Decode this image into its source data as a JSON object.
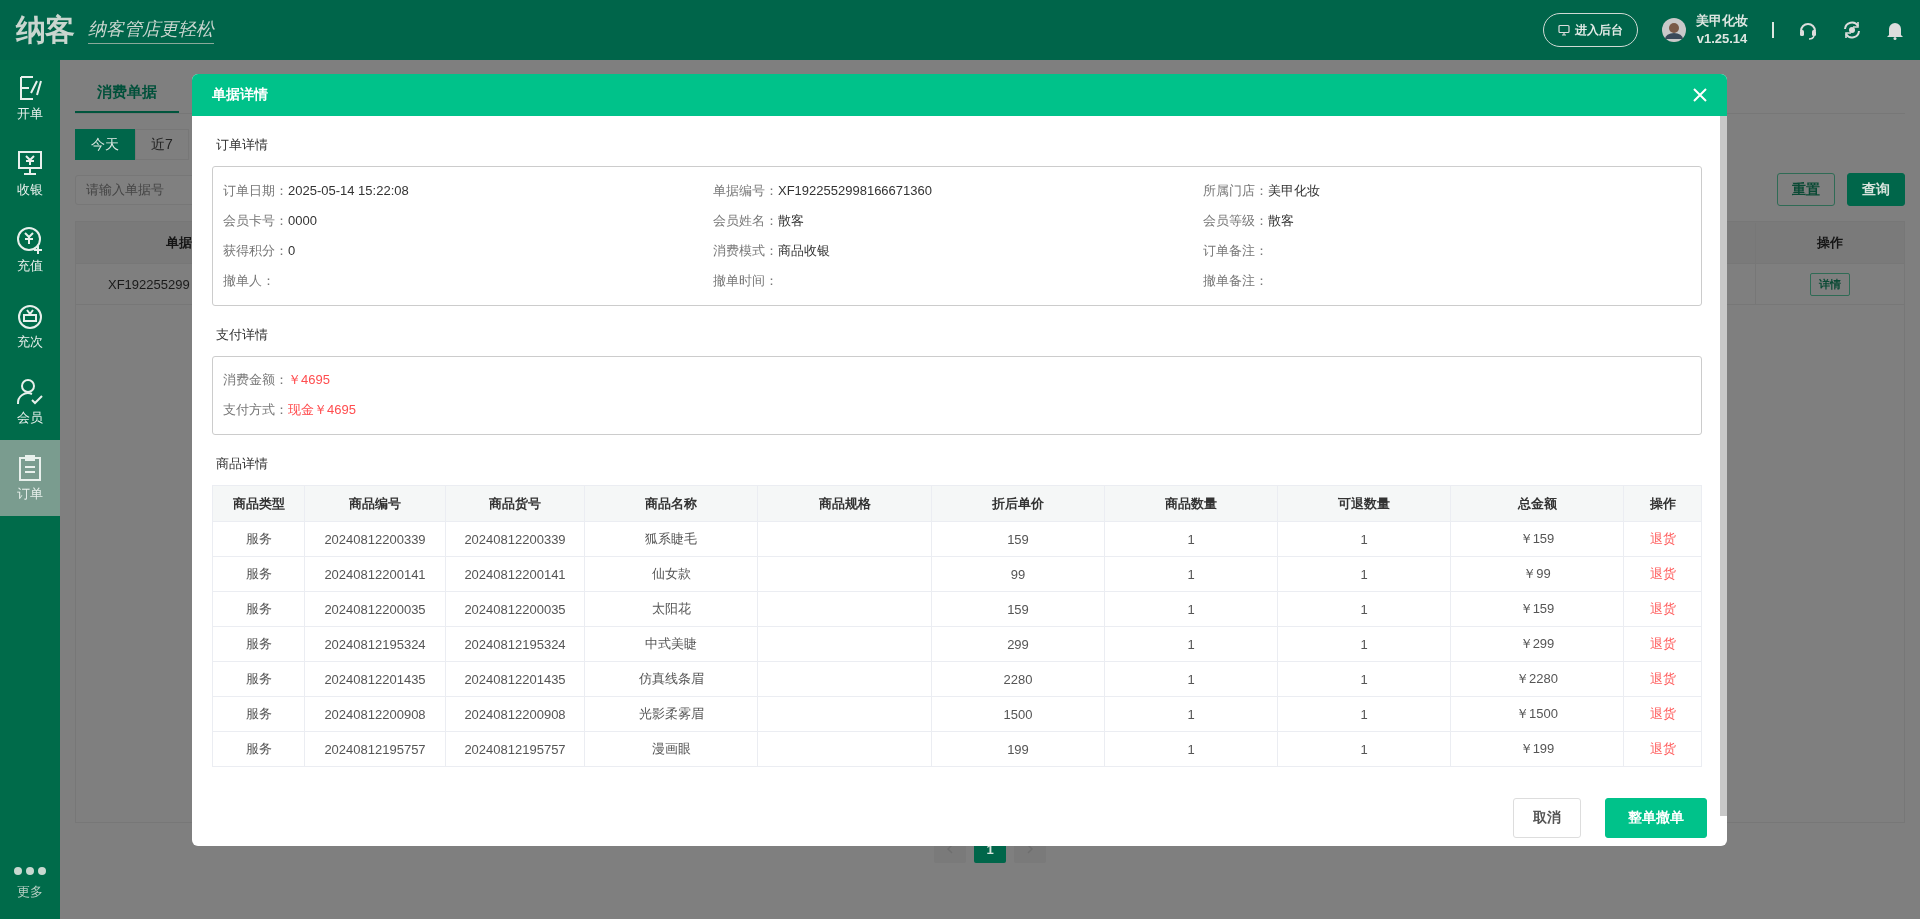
{
  "app": {
    "logo": "纳客",
    "slogan": "纳客管店更轻松"
  },
  "header": {
    "backend_button": "进入后台",
    "store_name": "美甲化妆",
    "version": "v1.25.14"
  },
  "sidebar": {
    "items": [
      {
        "label": "开单",
        "kind": "bill",
        "selected": false
      },
      {
        "label": "收银",
        "kind": "cashier",
        "selected": false
      },
      {
        "label": "充值",
        "kind": "recharge",
        "selected": false
      },
      {
        "label": "充次",
        "kind": "times",
        "selected": false
      },
      {
        "label": "会员",
        "kind": "member",
        "selected": false
      },
      {
        "label": "订单",
        "kind": "order",
        "selected": true
      }
    ],
    "more": "更多"
  },
  "page": {
    "tabs": [
      {
        "label": "消费单据",
        "selected": true
      }
    ],
    "date_filters": [
      {
        "label": "今天",
        "selected": true
      },
      {
        "label": "近7",
        "selected": false
      }
    ],
    "search": {
      "placeholder": "请输入单据号"
    },
    "buttons": [
      {
        "label": "重置",
        "primary": false
      },
      {
        "label": "查询",
        "primary": true
      }
    ],
    "table": {
      "columns": [
        "单据",
        "操作"
      ],
      "rows": [
        {
          "cells": [
            "XF192255299"
          ],
          "action": "详情"
        }
      ]
    },
    "pagination": {
      "pages": [
        {
          "label": "1",
          "selected": true
        }
      ]
    }
  },
  "dialog": {
    "title": "单据详情",
    "order_section": {
      "title": "订单详情",
      "fields": [
        {
          "label": "订单日期：",
          "value": "2025-05-14 15:22:08"
        },
        {
          "label": "单据编号：",
          "value": "XF1922552998166671360"
        },
        {
          "label": "所属门店：",
          "value": "美甲化妆"
        },
        {
          "label": "会员卡号：",
          "value": "0000"
        },
        {
          "label": "会员姓名：",
          "value": "散客"
        },
        {
          "label": "会员等级：",
          "value": "散客"
        },
        {
          "label": "获得积分：",
          "value": "0"
        },
        {
          "label": "消费模式：",
          "value": "商品收银"
        },
        {
          "label": "订单备注："
        },
        {
          "label": "撤单人："
        },
        {
          "label": "撤单时间："
        },
        {
          "label": "撤单备注："
        }
      ]
    },
    "payment_section": {
      "title": "支付详情",
      "fields": [
        {
          "label": "消费金额：",
          "value": "￥4695"
        },
        {
          "label": "支付方式：",
          "value": "现金￥4695"
        }
      ]
    },
    "goods_section": {
      "title": "商品详情",
      "columns": [
        "商品类型",
        "商品编号",
        "商品货号",
        "商品名称",
        "商品规格",
        "折后单价",
        "商品数量",
        "可退数量",
        "总金额",
        "操作"
      ],
      "rows": [
        {
          "cells": [
            "服务",
            "20240812200339",
            "20240812200339",
            "狐系睫毛",
            "",
            "159",
            "1",
            "1",
            "￥159"
          ],
          "action": "退货"
        },
        {
          "cells": [
            "服务",
            "20240812200141",
            "20240812200141",
            "仙女款",
            "",
            "99",
            "1",
            "1",
            "￥99"
          ],
          "action": "退货"
        },
        {
          "cells": [
            "服务",
            "20240812200035",
            "20240812200035",
            "太阳花",
            "",
            "159",
            "1",
            "1",
            "￥159"
          ],
          "action": "退货"
        },
        {
          "cells": [
            "服务",
            "20240812195324",
            "20240812195324",
            "中式美睫",
            "",
            "299",
            "1",
            "1",
            "￥299"
          ],
          "action": "退货"
        },
        {
          "cells": [
            "服务",
            "20240812201435",
            "20240812201435",
            "仿真线条眉",
            "",
            "2280",
            "1",
            "1",
            "￥2280"
          ],
          "action": "退货"
        },
        {
          "cells": [
            "服务",
            "20240812200908",
            "20240812200908",
            "光影柔雾眉",
            "",
            "1500",
            "1",
            "1",
            "￥1500"
          ],
          "action": "退货"
        },
        {
          "cells": [
            "服务",
            "20240812195757",
            "20240812195757",
            "漫画眼",
            "",
            "199",
            "1",
            "1",
            "￥199"
          ],
          "action": "退货"
        }
      ]
    },
    "buttons": [
      {
        "label": "取消",
        "primary": false
      },
      {
        "label": "整单撤单",
        "primary": true
      }
    ]
  }
}
